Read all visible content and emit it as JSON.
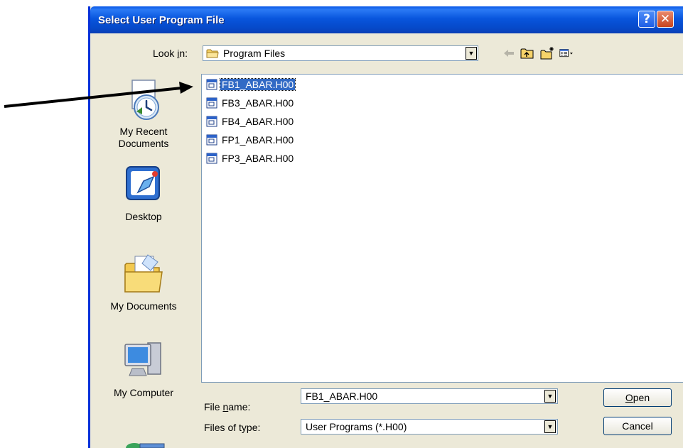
{
  "dialog": {
    "title": "Select User Program File"
  },
  "title_buttons": {
    "help": "?",
    "close": "✕"
  },
  "look_in": {
    "label_pre": "Look ",
    "label_accel": "i",
    "label_post": "n:",
    "value": "Program Files"
  },
  "nav_icons": [
    "back-icon",
    "up-one-level-icon",
    "new-folder-icon",
    "view-menu-icon"
  ],
  "places": [
    {
      "label_line1": "My Recent",
      "label_line2": "Documents",
      "icon": "recent-documents-icon"
    },
    {
      "label_line1": "Desktop",
      "label_line2": "",
      "icon": "desktop-icon"
    },
    {
      "label_line1": "My Documents",
      "label_line2": "",
      "icon": "my-documents-icon"
    },
    {
      "label_line1": "My Computer",
      "label_line2": "",
      "icon": "my-computer-icon"
    }
  ],
  "files": [
    {
      "name": "FB1_ABAR.H00",
      "selected": true
    },
    {
      "name": "FB3_ABAR.H00",
      "selected": false
    },
    {
      "name": "FB4_ABAR.H00",
      "selected": false
    },
    {
      "name": "FP1_ABAR.H00",
      "selected": false
    },
    {
      "name": "FP3_ABAR.H00",
      "selected": false
    }
  ],
  "file_name": {
    "label_pre": "File ",
    "label_accel": "n",
    "label_post": "ame:",
    "value": "FB1_ABAR.H00"
  },
  "file_type": {
    "label": "Files of type:",
    "value": "User Programs (*.H00)"
  },
  "buttons": {
    "open_accel": "O",
    "open_rest": "pen",
    "cancel": "Cancel"
  },
  "colors": {
    "titlebar": "#0855dd",
    "selection": "#316ac5",
    "dialog_bg": "#ece9d8"
  }
}
